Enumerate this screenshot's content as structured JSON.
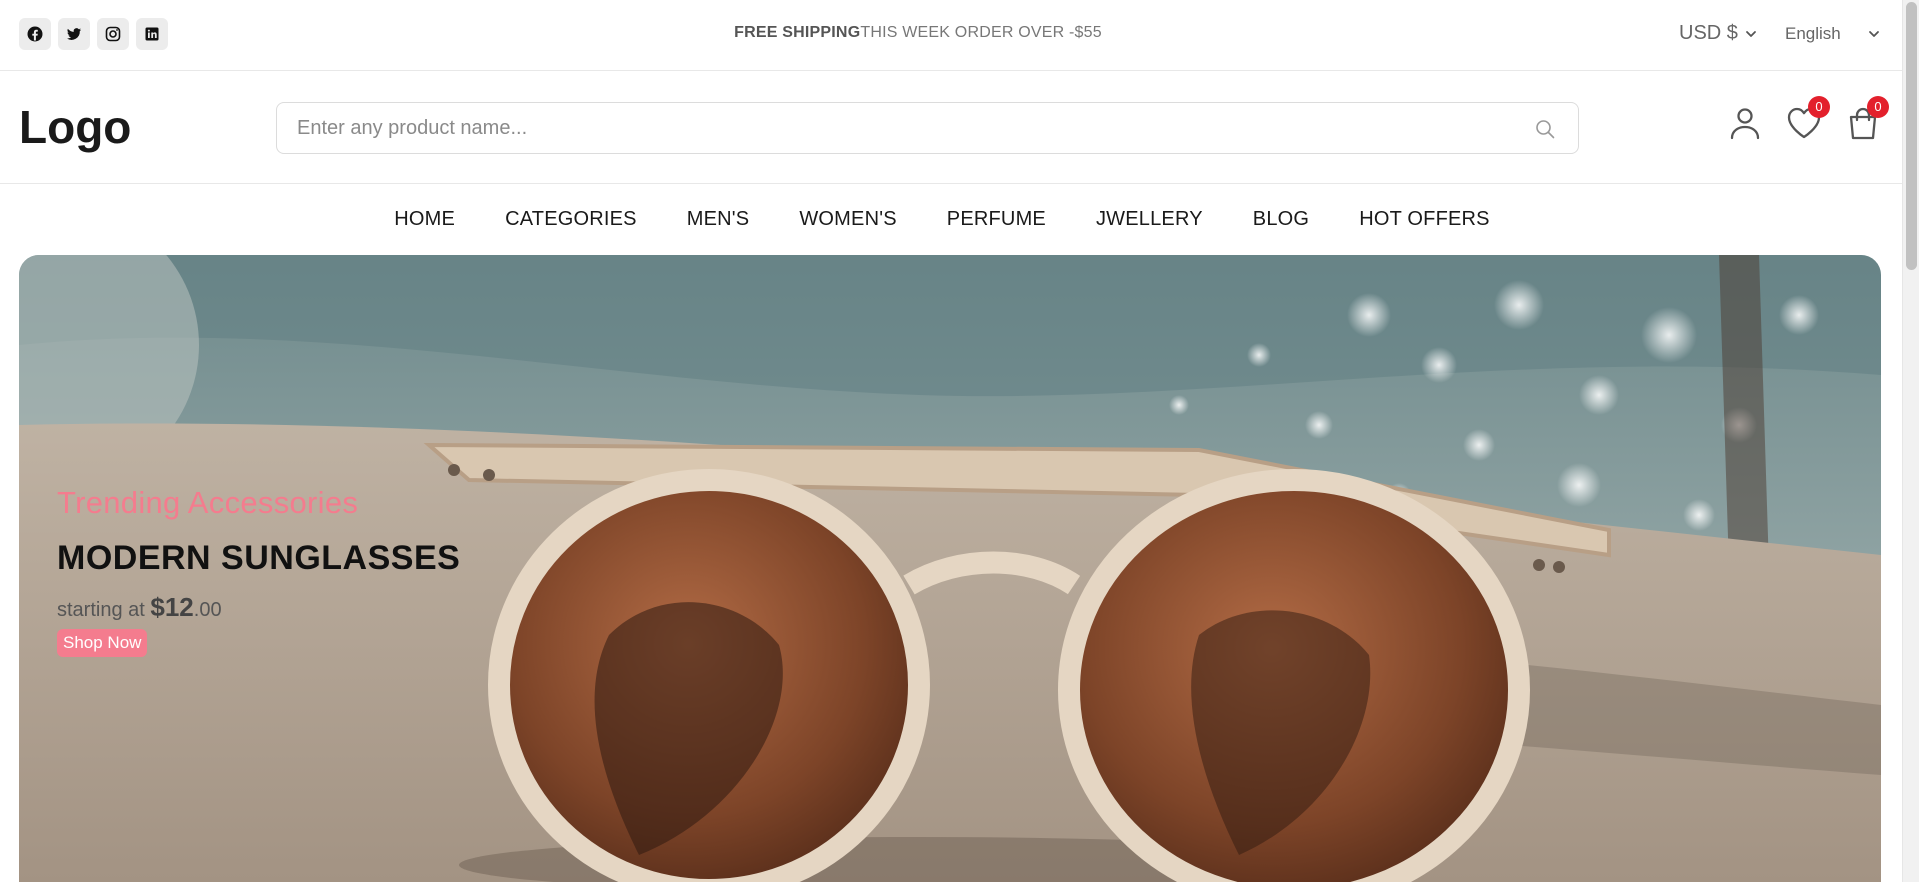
{
  "topbar": {
    "socials": [
      "facebook-icon",
      "twitter-icon",
      "instagram-icon",
      "linkedin-icon"
    ],
    "shipping_bold": "FREE SHIPPING",
    "shipping_text": "THIS WEEK ORDER OVER -$55",
    "currency": "USD $",
    "language": "English"
  },
  "header": {
    "logo": "Logo",
    "search_placeholder": "Enter any product name...",
    "wishlist_count": "0",
    "cart_count": "0"
  },
  "nav": {
    "items": [
      "HOME",
      "CATEGORIES",
      "MEN'S",
      "WOMEN'S",
      "PERFUME",
      "JWELLERY",
      "BLOG",
      "HOT OFFERS"
    ]
  },
  "hero": {
    "subtitle": "Trending Accessories",
    "title": "MODERN SUNGLASSES",
    "price_prefix": "starting at ",
    "price_main": "$12",
    "price_cents": ".00",
    "button": "Shop Now"
  },
  "colors": {
    "accent": "#f47c8e",
    "badge": "#e3202c"
  }
}
